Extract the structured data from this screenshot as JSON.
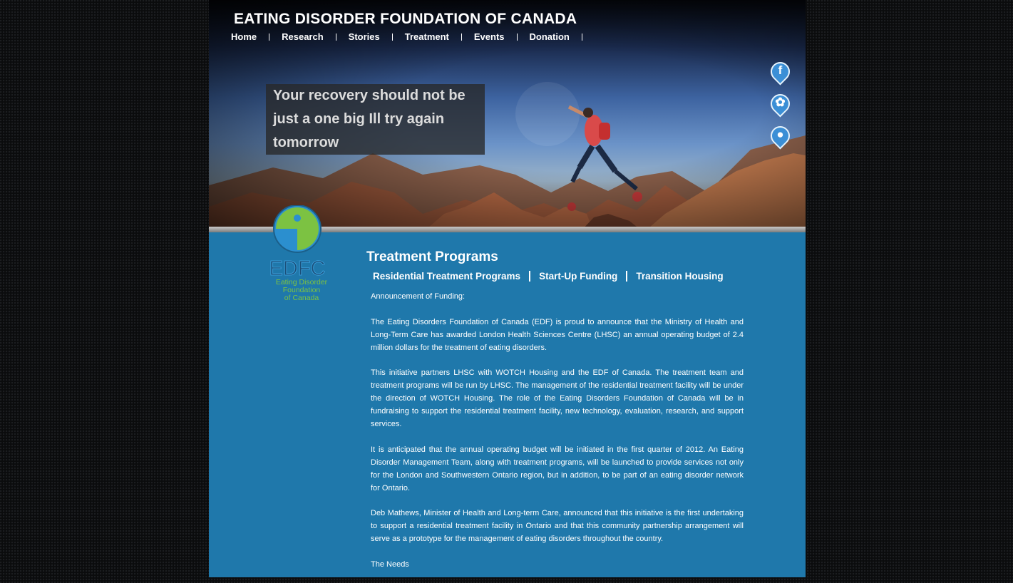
{
  "header": {
    "site_title": "EATING DISORDER FOUNDATION OF CANADA",
    "nav": [
      "Home",
      "Research",
      "Stories",
      "Treatment",
      "Events",
      "Donation"
    ]
  },
  "hero": {
    "tagline": "Your recovery should not be just a one big Ill try again tomorrow"
  },
  "social": [
    {
      "icon": "facebook-icon",
      "glyph": "f"
    },
    {
      "icon": "brain-icon",
      "glyph": "✿"
    },
    {
      "icon": "location-icon",
      "glyph": "●"
    }
  ],
  "logo": {
    "abbr": "EDFC",
    "line1": "Eating Disorder",
    "line2": "Foundation",
    "line3": "of Canada"
  },
  "main": {
    "title": "Treatment Programs",
    "tabs": [
      "Residential Treatment Programs",
      "Start-Up Funding",
      "Transition Housing"
    ],
    "paragraphs": [
      "Announcement of Funding:",
      "The Eating Disorders Foundation of Canada (EDF) is proud to announce that the Ministry of Health and Long-Term Care has awarded London Health Sciences Centre (LHSC) an annual operating budget of 2.4 million dollars for the treatment of eating disorders.",
      "This initiative partners LHSC with WOTCH Housing and the EDF of Canada. The treatment team and treatment programs will be run by LHSC. The management of the residential treatment facility will be under the direction of WOTCH Housing. The role of the Eating Disorders Foundation of Canada will be in fundraising to support the residential treatment facility, new technology, evaluation, research, and support services.",
      "It is anticipated that the annual operating budget will be initiated in the first quarter of 2012. An Eating Disorder Management Team, along with treatment programs, will be launched to provide services not only for the London and Southwestern Ontario region, but in addition, to be part of an eating disorder network for Ontario.",
      "Deb Mathews, Minister of Health and Long-term Care, announced that this initiative is the first undertaking to support a residential treatment facility in Ontario and that this community partnership arrangement will serve as a prototype for the management of eating disorders throughout the country.",
      "The Needs"
    ]
  },
  "colors": {
    "content_bg": "#1f78ab",
    "social_blue": "#3b8fd6",
    "logo_green": "#7cc242"
  }
}
